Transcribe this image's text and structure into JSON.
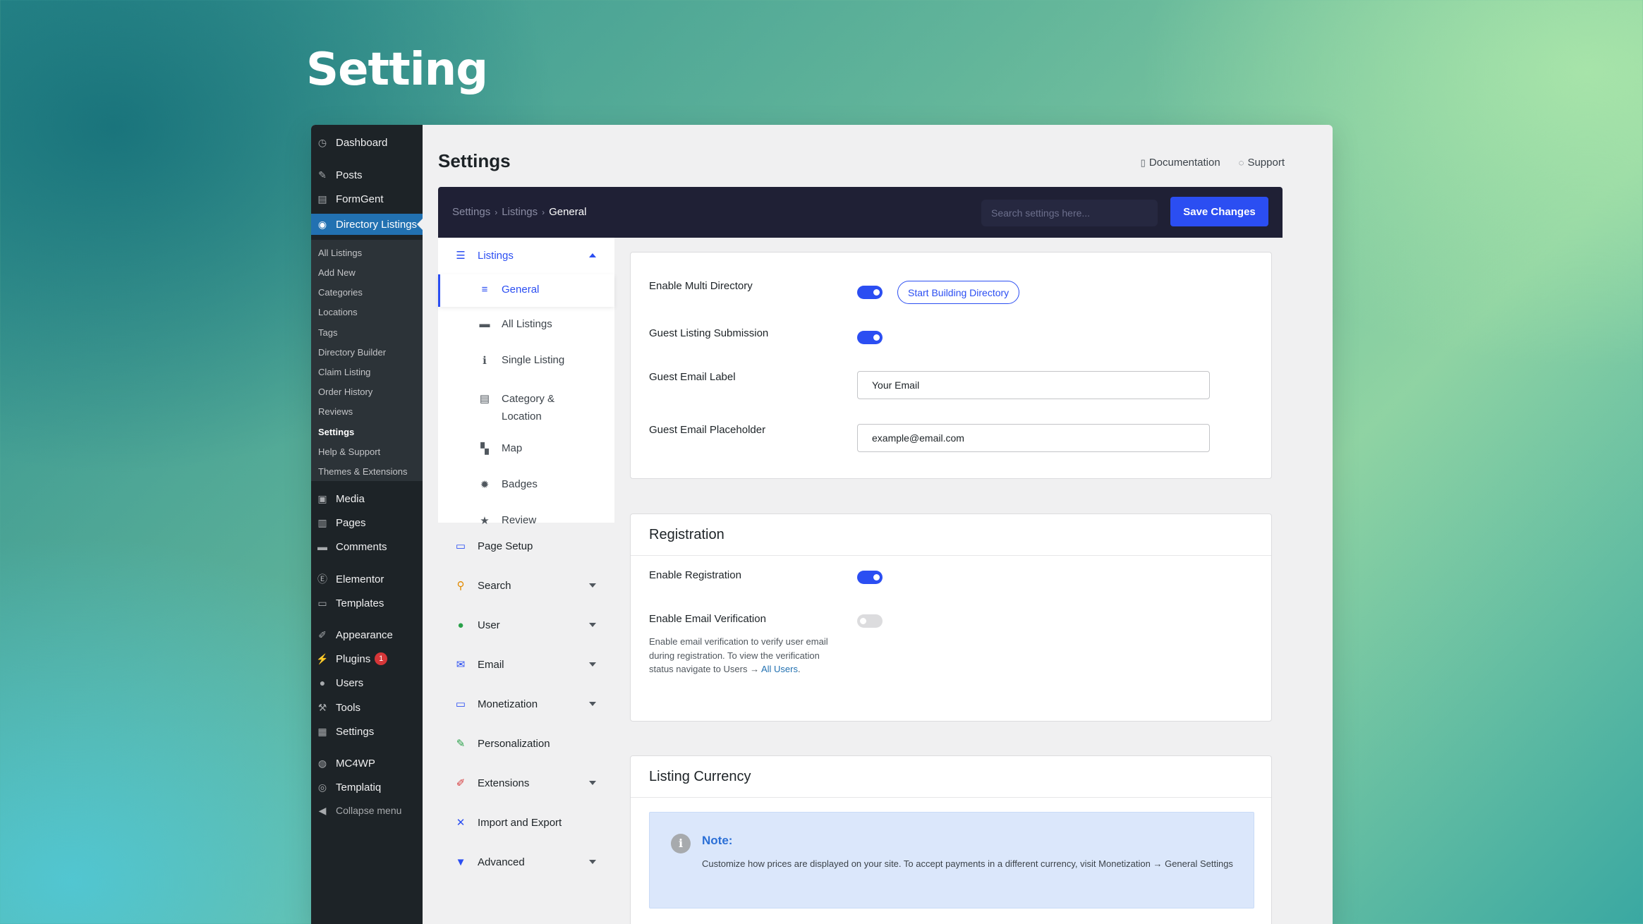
{
  "hero": {
    "title": "Setting"
  },
  "wp_menu": {
    "items": [
      {
        "label": "Dashboard",
        "icon": "dashboard-icon"
      },
      {
        "label": "Posts",
        "icon": "pin-icon"
      },
      {
        "label": "FormGent",
        "icon": "form-icon"
      },
      {
        "label": "Directory Listings",
        "icon": "directory-icon"
      },
      {
        "label": "Media",
        "icon": "media-icon"
      },
      {
        "label": "Pages",
        "icon": "pages-icon"
      },
      {
        "label": "Comments",
        "icon": "comment-icon"
      },
      {
        "label": "Elementor",
        "icon": "elementor-icon"
      },
      {
        "label": "Templates",
        "icon": "folder-icon"
      },
      {
        "label": "Appearance",
        "icon": "brush-icon"
      },
      {
        "label": "Plugins",
        "icon": "plugin-icon",
        "badge": "1"
      },
      {
        "label": "Users",
        "icon": "user-icon"
      },
      {
        "label": "Tools",
        "icon": "wrench-icon"
      },
      {
        "label": "Settings",
        "icon": "settings-icon"
      },
      {
        "label": "MC4WP",
        "icon": "mc4wp-icon"
      },
      {
        "label": "Templatiq",
        "icon": "templatiq-icon"
      },
      {
        "label": "Collapse menu",
        "icon": "collapse-icon"
      }
    ],
    "submenu": [
      "All Listings",
      "Add New",
      "Categories",
      "Locations",
      "Tags",
      "Directory Builder",
      "Claim Listing",
      "Order History",
      "Reviews",
      "Settings",
      "Help & Support",
      "Themes & Extensions"
    ]
  },
  "header": {
    "title": "Settings",
    "documentation": "Documentation",
    "support": "Support"
  },
  "topbar": {
    "breadcrumb": [
      "Settings",
      "Listings",
      "General"
    ],
    "search_placeholder": "Search settings here...",
    "save_label": "Save Changes"
  },
  "settings_nav": {
    "listings": "Listings",
    "listings_sub": [
      "General",
      "All Listings",
      "Single Listing",
      "Category & Location",
      "Map",
      "Badges",
      "Review"
    ],
    "sections": [
      "Page Setup",
      "Search",
      "User",
      "Email",
      "Monetization",
      "Personalization",
      "Extensions",
      "Import and Export",
      "Advanced"
    ]
  },
  "general_panel": {
    "multi_directory_label": "Enable Multi Directory",
    "multi_directory_enabled": true,
    "start_building": "Start Building Directory",
    "guest_submission_label": "Guest Listing Submission",
    "guest_submission_enabled": true,
    "guest_email_label": "Guest Email Label",
    "guest_email_label_value": "Your Email",
    "guest_email_placeholder_label": "Guest Email Placeholder",
    "guest_email_placeholder_value": "example@email.com"
  },
  "registration_panel": {
    "title": "Registration",
    "enable_registration_label": "Enable Registration",
    "enable_registration_enabled": true,
    "email_verification_label": "Enable Email Verification",
    "email_verification_enabled": false,
    "help_text": "Enable email verification to verify user email during registration. To view the verification status navigate to Users →",
    "help_link": "All Users",
    "help_end": "."
  },
  "currency_panel": {
    "title": "Listing Currency",
    "note_title": "Note:",
    "note_body": "Customize how prices are displayed on your site. To accept payments in a different currency, visit Monetization → General Settings"
  },
  "colors": {
    "accent": "#2b4ef2",
    "wp_sidebar": "#1d2327",
    "wp_active": "#2271b1",
    "topbar": "#1f2035"
  }
}
